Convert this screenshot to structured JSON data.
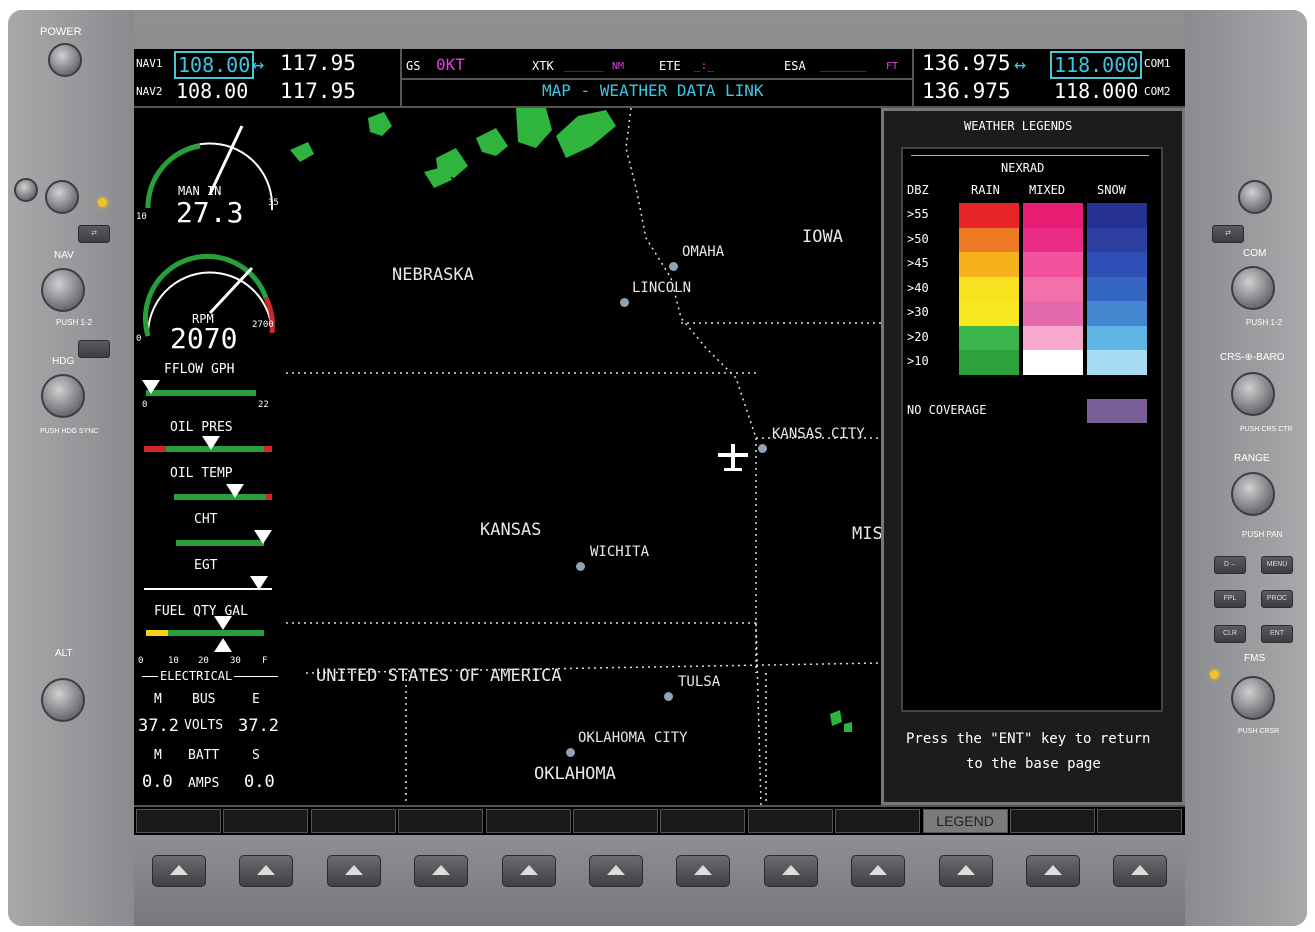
{
  "bezel": {
    "left": {
      "power": "POWER",
      "nav": "NAV",
      "push_12": "PUSH 1-2",
      "hdg": "HDG",
      "push_hdg": "PUSH HDG SYNC",
      "alt": "ALT"
    },
    "right": {
      "com": "COM",
      "push_12": "PUSH 1-2",
      "crs_baro": "CRS-⊕-BARO",
      "push_crs": "PUSH CRS CTR",
      "range": "RANGE",
      "push_pan": "PUSH PAN",
      "fms": "FMS",
      "push_crsr": "PUSH CRSR",
      "buttons": [
        "D→",
        "MENU",
        "FPL",
        "PROC",
        "CLR",
        "ENT"
      ]
    }
  },
  "nav": {
    "nav1_label": "NAV1",
    "nav1_active": "108.00",
    "nav1_arrow": "↔",
    "nav1_standby": "117.95",
    "nav2_label": "NAV2",
    "nav2_active": "108.00",
    "nav2_standby": "117.95"
  },
  "datafields": {
    "gs_label": "GS",
    "gs_value": "0KT",
    "xtk_label": "XTK",
    "xtk_unit": "NM",
    "ete_label": "ETE",
    "ete_value": "_:_",
    "esa_label": "ESA",
    "esa_unit": "FT",
    "page_title": "MAP - WEATHER DATA LINK"
  },
  "com": {
    "com1_label": "COM1",
    "com1_standby": "136.975",
    "com1_arrow": "↔",
    "com1_active": "118.000",
    "com2_label": "COM2",
    "com2_standby": "136.975",
    "com2_active": "118.000"
  },
  "eis": {
    "man_in_label": "MAN IN",
    "man_in_value": "27.3",
    "man_min": "10",
    "man_max": "35",
    "rpm_label": "RPM",
    "rpm_value": "2070",
    "rpm_min": "0",
    "rpm_max": "2700",
    "fflow_label": "FFLOW GPH",
    "fflow_min": "0",
    "fflow_max": "22",
    "oil_pres_label": "OIL PRES",
    "oil_temp_label": "OIL TEMP",
    "cht_label": "CHT",
    "egt_label": "EGT",
    "fuel_qty_label": "FUEL QTY GAL",
    "fuel_ticks": [
      "0",
      "10",
      "20",
      "30",
      "F"
    ],
    "electrical_label": "ELECTRICAL",
    "bus_m": "M",
    "bus_label": "BUS",
    "bus_e": "E",
    "volts_m": "37.2",
    "volts_label": "VOLTS",
    "volts_e": "37.2",
    "batt_m": "M",
    "batt_label": "BATT",
    "batt_s": "S",
    "amps_m": "0.0",
    "amps_label": "AMPS",
    "amps_s": "0.0"
  },
  "map": {
    "states": [
      "NEBRASKA",
      "IOWA",
      "KANSAS",
      "MIS",
      "OKLAHOMA"
    ],
    "country": "UNITED STATES OF AMERICA",
    "cities": [
      "OMAHA",
      "LINCOLN",
      "KANSAS CITY",
      "WICHITA",
      "TULSA",
      "OKLAHOMA CITY"
    ]
  },
  "legend": {
    "title": "WEATHER LEGENDS",
    "nexrad": "NEXRAD",
    "dbz": "DBZ",
    "cols": [
      "RAIN",
      "MIXED",
      "SNOW"
    ],
    "rows": [
      ">55",
      ">50",
      ">45",
      ">40",
      ">30",
      ">20",
      ">10"
    ],
    "no_coverage": "NO COVERAGE",
    "footer_line1": "Press the \"ENT\" key to return",
    "footer_line2": "to the base page",
    "colors": {
      "rain": [
        "#e8262a",
        "#ef7a25",
        "#f6b21c",
        "#f8e21f",
        "#f8e81f",
        "#3cb54a",
        "#2ca23c"
      ],
      "mixed": [
        "#e61d72",
        "#ec2b87",
        "#f2519d",
        "#f271aa",
        "#e56aad",
        "#f6a9cc",
        "#ffffff"
      ],
      "snow": [
        "#25318f",
        "#2a3fa0",
        "#2f4fb6",
        "#3566c4",
        "#4586d0",
        "#5fb6e4",
        "#a8dcf4"
      ],
      "no_coverage": "#7a5f97"
    }
  },
  "softkeys": [
    "",
    "",
    "",
    "",
    "",
    "",
    "",
    "",
    "",
    "LEGEND",
    "",
    ""
  ]
}
